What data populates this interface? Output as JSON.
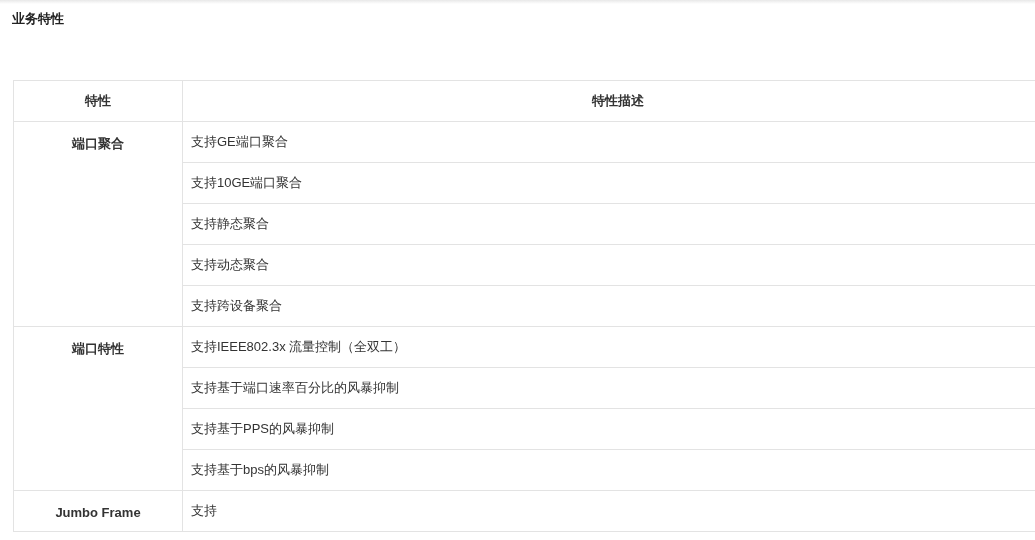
{
  "title": "业务特性",
  "table": {
    "columns": [
      "特性",
      "特性描述"
    ],
    "groups": [
      {
        "feature": "端口聚合",
        "descriptions": [
          "支持GE端口聚合",
          "支持10GE端口聚合",
          "支持静态聚合",
          "支持动态聚合",
          "支持跨设备聚合"
        ]
      },
      {
        "feature": "端口特性",
        "descriptions": [
          "支持IEEE802.3x 流量控制（全双工）",
          "支持基于端口速率百分比的风暴抑制",
          "支持基于PPS的风暴抑制",
          "支持基于bps的风暴抑制"
        ]
      },
      {
        "feature": "Jumbo Frame",
        "descriptions": [
          "支持"
        ]
      }
    ]
  }
}
